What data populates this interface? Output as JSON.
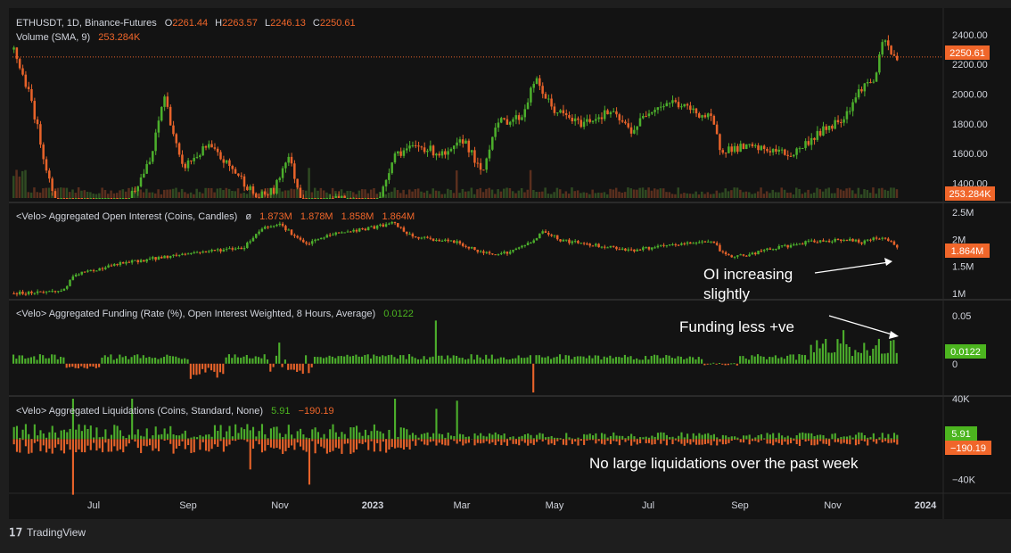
{
  "colors": {
    "background": "#131313",
    "frame": "#1e1e1e",
    "up": "#4caf2c",
    "down": "#e8632a",
    "text": "#d1d4dc",
    "orange_value": "#f0662a",
    "green_value": "#4cb51f",
    "annotation": "#ffffff"
  },
  "footer": {
    "brand": "TradingView"
  },
  "chart_data": [
    {
      "type": "candlestick",
      "pane": "price",
      "legend": {
        "symbol": "ETHUSDT, 1D, Binance-Futures",
        "o_label": "O",
        "o": "2261.44",
        "h_label": "H",
        "h": "2263.57",
        "l_label": "L",
        "l": "2246.13",
        "c_label": "C",
        "c": "2250.61",
        "volume_label": "Volume (SMA, 9)",
        "volume_value": "253.284K"
      },
      "ylim": [
        1300,
        2550
      ],
      "y_ticks": [
        "2400.00",
        "2200.00",
        "2000.00",
        "1800.00",
        "1600.00",
        "1400.00"
      ],
      "last_price_label": "2250.61",
      "volume_label": "253.284K",
      "x_ticks": [
        "Jul",
        "Sep",
        "Nov",
        "2023",
        "Mar",
        "May",
        "Jul",
        "Sep",
        "Nov",
        "2024"
      ],
      "close_keyframes": [
        [
          0,
          2300
        ],
        [
          0.02,
          1950
        ],
        [
          0.05,
          1150
        ],
        [
          0.08,
          1050
        ],
        [
          0.12,
          1200
        ],
        [
          0.155,
          1550
        ],
        [
          0.17,
          2000
        ],
        [
          0.19,
          1500
        ],
        [
          0.22,
          1650
        ],
        [
          0.255,
          1450
        ],
        [
          0.275,
          1300
        ],
        [
          0.295,
          1350
        ],
        [
          0.31,
          1600
        ],
        [
          0.33,
          1200
        ],
        [
          0.36,
          1300
        ],
        [
          0.4,
          1250
        ],
        [
          0.41,
          1200
        ],
        [
          0.43,
          1600
        ],
        [
          0.46,
          1650
        ],
        [
          0.49,
          1580
        ],
        [
          0.51,
          1700
        ],
        [
          0.53,
          1450
        ],
        [
          0.545,
          1800
        ],
        [
          0.575,
          1850
        ],
        [
          0.59,
          2100
        ],
        [
          0.61,
          1900
        ],
        [
          0.64,
          1800
        ],
        [
          0.675,
          1880
        ],
        [
          0.7,
          1750
        ],
        [
          0.72,
          1900
        ],
        [
          0.745,
          1950
        ],
        [
          0.79,
          1830
        ],
        [
          0.8,
          1630
        ],
        [
          0.83,
          1640
        ],
        [
          0.86,
          1620
        ],
        [
          0.88,
          1590
        ],
        [
          0.91,
          1730
        ],
        [
          0.94,
          1850
        ],
        [
          0.96,
          2050
        ],
        [
          0.975,
          2100
        ],
        [
          0.985,
          2380
        ],
        [
          0.995,
          2250
        ]
      ]
    },
    {
      "type": "candlestick",
      "pane": "open_interest",
      "legend": {
        "name": "<Velo> Aggregated Open Interest (Coins, Candles)",
        "symbol": "ø",
        "v1": "1.873M",
        "v2": "1.878M",
        "v3": "1.858M",
        "v4": "1.864M"
      },
      "ylim": [
        0.95,
        2.6
      ],
      "y_ticks": [
        "2.5M",
        "2M",
        "1.5M",
        "1M"
      ],
      "last_label": "1.864M",
      "annotation": [
        "OI increasing",
        "slightly"
      ],
      "keyframes": [
        [
          0,
          1
        ],
        [
          0.055,
          1.05
        ],
        [
          0.07,
          1.35
        ],
        [
          0.12,
          1.55
        ],
        [
          0.2,
          1.75
        ],
        [
          0.26,
          1.85
        ],
        [
          0.28,
          2.2
        ],
        [
          0.3,
          2.3
        ],
        [
          0.33,
          1.9
        ],
        [
          0.36,
          2.1
        ],
        [
          0.4,
          2.2
        ],
        [
          0.43,
          2.3
        ],
        [
          0.45,
          2.05
        ],
        [
          0.5,
          1.95
        ],
        [
          0.53,
          1.75
        ],
        [
          0.56,
          1.75
        ],
        [
          0.585,
          1.95
        ],
        [
          0.6,
          2.15
        ],
        [
          0.62,
          1.98
        ],
        [
          0.7,
          1.8
        ],
        [
          0.75,
          1.9
        ],
        [
          0.79,
          1.98
        ],
        [
          0.805,
          1.7
        ],
        [
          0.83,
          1.7
        ],
        [
          0.85,
          1.8
        ],
        [
          0.9,
          1.95
        ],
        [
          0.94,
          2.0
        ],
        [
          0.96,
          1.95
        ],
        [
          0.985,
          2.05
        ],
        [
          1,
          1.86
        ]
      ]
    },
    {
      "type": "bar",
      "pane": "funding",
      "legend": {
        "name": "<Velo> Aggregated Funding (Rate (%), Open Interest Weighted, 8 Hours, Average)",
        "value": "0.0122"
      },
      "ylim": [
        -0.03,
        0.05
      ],
      "y_ticks": [
        "0.05",
        "0"
      ],
      "last_label": "0.0122",
      "annotation": [
        "Funding less +ve"
      ]
    },
    {
      "type": "bar",
      "pane": "liquidations",
      "legend": {
        "name": "<Velo> Aggregated Liquidations (Coins, Standard, None)",
        "v_green": "5.91",
        "v_red": "−190.19"
      },
      "ylim": [
        -50000,
        40000
      ],
      "y_ticks": [
        "40K",
        "−40K"
      ],
      "last_green_label": "5.91",
      "last_red_label": "−190.19",
      "annotation": [
        "No large liquidations over the past week"
      ]
    }
  ]
}
